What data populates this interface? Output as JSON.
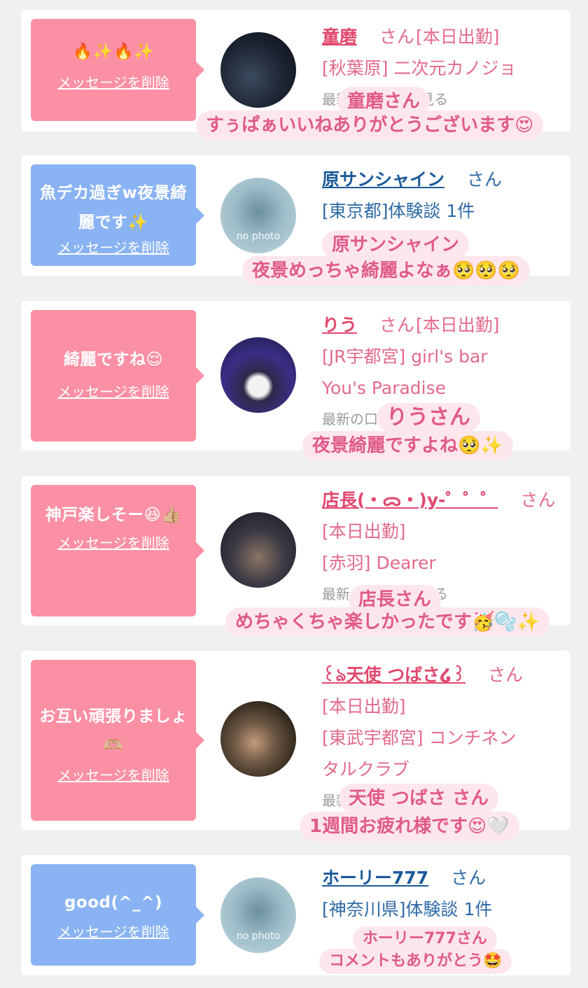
{
  "cards": [
    {
      "message": "🔥✨🔥✨",
      "delete_label": "メッセージを削除",
      "name": "童磨",
      "san": "さん",
      "status": "[本日出勤]",
      "line2": "[秋葉原] 二次元カノジョ",
      "line3": "最新の口コミを見る",
      "overlay1": "童磨さん",
      "overlay2": "すぅぱぁいいねありがとうございます😍"
    },
    {
      "message": "魚デカ過ぎw夜景綺麗です✨",
      "delete_label": "メッセージを削除",
      "name": "原サンシャイン",
      "san": "さん",
      "line2": "[東京都]体験談 1件",
      "nophoto": "no photo",
      "overlay1": "原サンシャイン",
      "overlay2": "夜景めっちゃ綺麗よなぁ🥺🥺🥺"
    },
    {
      "message": "綺麗ですね😌",
      "delete_label": "メッセージを削除",
      "name": "りう",
      "san": "さん",
      "status": "[本日出勤]",
      "line2": "[JR宇都宮] girl's bar",
      "line3": "You's Paradise",
      "line4": "最新の口コミを見る",
      "overlay1": "りうさん",
      "overlay2": "夜景綺麗ですよね🥺✨"
    },
    {
      "message": "神戸楽しそー😆👍🏼",
      "delete_label": "メッセージを削除",
      "name": "店長(・ᯅ・)y-゜゜゜",
      "san": "さん",
      "line2": "[本日出勤]",
      "line3": "[赤羽] Dearer",
      "line4": "最新の口コミを見る",
      "overlay1": "店長さん",
      "overlay2": "めちゃくちゃ楽しかったです🥳🫧✨"
    },
    {
      "message": "お互い頑張りましょ🫶🏼",
      "delete_label": "メッセージを削除",
      "name": "꒰ঌ天使 つばさ໒꒱",
      "san": "さん",
      "line2": "[本日出勤]",
      "line3": "[東武宇都宮] コンチネン",
      "line4": "タルクラブ",
      "line5": "最新の口コミを見る",
      "overlay1": "天使 つばさ さん",
      "overlay2": "1週間お疲れ様です😍🤍"
    },
    {
      "message": "good(^_^)",
      "delete_label": "メッセージを削除",
      "name": "ホーリー777",
      "san": "さん",
      "line2": "[神奈川県]体験談 1件",
      "nophoto": "no photo",
      "overlay1": "ホーリー777さん",
      "overlay2": "コメントもありがとう🤩"
    }
  ]
}
